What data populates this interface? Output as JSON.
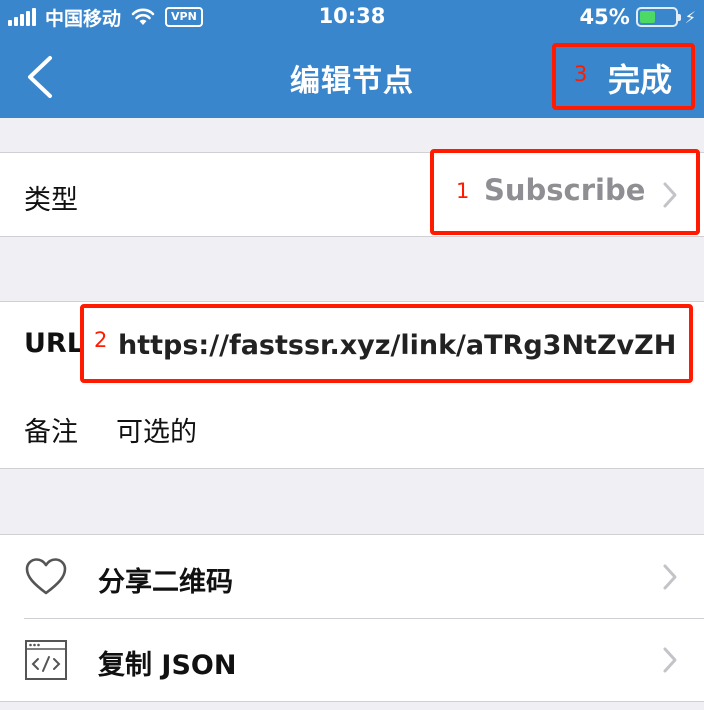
{
  "status_bar": {
    "carrier": "中国移动",
    "vpn": "VPN",
    "time": "10:38",
    "battery_percent": "45%",
    "battery_level": 0.45
  },
  "nav": {
    "back_icon": "chevron-left-icon",
    "title": "编辑节点",
    "done_number": "3",
    "done_label": "完成"
  },
  "type_row": {
    "label": "类型",
    "number": "1",
    "value": "Subscribe"
  },
  "url_row": {
    "label": "URL",
    "number": "2",
    "value": "https://fastssr.xyz/link/aTRg3NtZvZH..."
  },
  "note_row": {
    "label": "备注",
    "placeholder": "可选的"
  },
  "actions": [
    {
      "label": "分享二维码",
      "icon": "heart-icon"
    },
    {
      "label": "复制 JSON",
      "icon": "code-window-icon"
    }
  ],
  "colors": {
    "nav_bg": "#3a86cc",
    "highlight": "#ff1a00",
    "battery": "#4cd964"
  }
}
